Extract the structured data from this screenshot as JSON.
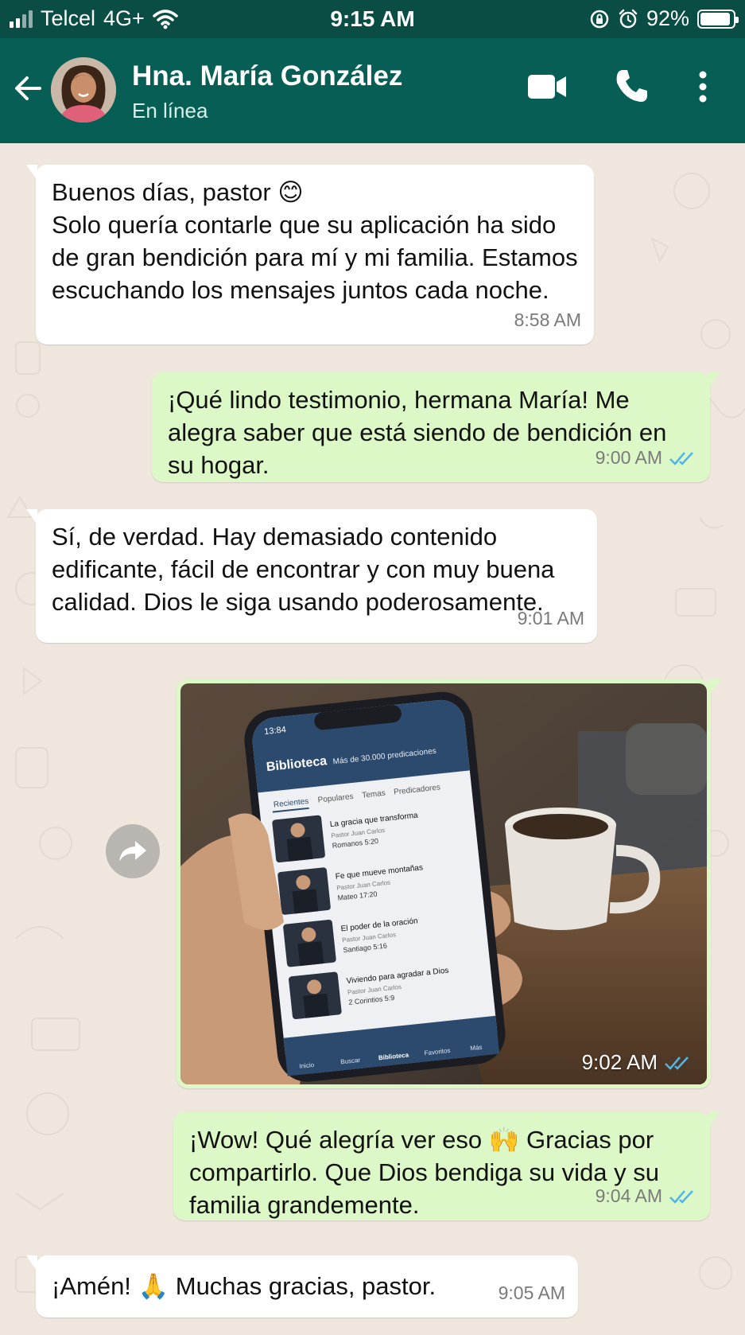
{
  "status_bar": {
    "carrier": "Telcel",
    "network": "4G+",
    "time": "9:15 AM",
    "battery": "92%",
    "battery_level": 0.92
  },
  "header": {
    "contact_name": "Hna. María González",
    "contact_status": "En línea",
    "icons": [
      "back-arrow-icon",
      "video-call-icon",
      "phone-icon",
      "more-vert-icon"
    ]
  },
  "messages": [
    {
      "direction": "in",
      "text": "Buenos días, pastor 😊\nSolo quería contarle que su aplicación ha sido de gran bendición para mí y mi familia. Estamos escuchando los mensajes juntos cada noche.",
      "time": "8:58 AM"
    },
    {
      "direction": "out",
      "text": "¡Qué lindo testimonio, hermana María! Me alegra saber que está siendo de bendición en su hogar.",
      "time": "9:00 AM",
      "status": "read"
    },
    {
      "direction": "in",
      "text": "Sí, de verdad. Hay demasiado contenido edificante, fácil de encontrar y con muy buena calidad. Dios le siga usando poderosamente.",
      "time": "9:01 AM"
    },
    {
      "direction": "out",
      "type": "image",
      "time": "9:02 AM",
      "status": "read",
      "image": {
        "app_time": "13:84",
        "app_title": "Biblioteca",
        "app_subtitle": "Más de 30.000 predicaciones",
        "tabs": [
          "Recientes",
          "Populares",
          "Temas",
          "Predicadores"
        ],
        "items": [
          {
            "title": "La gracia que transforma",
            "author": "Pastor Juan Carlos",
            "verse": "Romanos 5:20"
          },
          {
            "title": "Fe que mueve montañas",
            "author": "Pastor Juan Carlos",
            "verse": "Mateo 17:20"
          },
          {
            "title": "El poder de la oración",
            "author": "Pastor Juan Carlos",
            "verse": "Santiago 5:16"
          },
          {
            "title": "Viviendo para agradar a Dios",
            "author": "Pastor Juan Carlos",
            "verse": "2 Corintios 5:9"
          }
        ],
        "nav": [
          "Inicio",
          "Buscar",
          "Biblioteca",
          "Favoritos",
          "Más"
        ]
      }
    },
    {
      "direction": "out",
      "text": "¡Wow! Qué alegría ver eso 🙌 Gracias por compartirlo. Que Dios bendiga su vida y su familia grandemente.",
      "time": "9:04 AM",
      "status": "read"
    },
    {
      "direction": "in",
      "text": "¡Amén! 🙏 Muchas gracias, pastor.",
      "time": "9:05 AM"
    }
  ],
  "colors": {
    "header": "#075e54",
    "status_bar": "#0a4d45",
    "chat_bg": "#efe7de",
    "bubble_in": "#ffffff",
    "bubble_out": "#dcf8c6",
    "read_tick": "#4fb6ec"
  }
}
